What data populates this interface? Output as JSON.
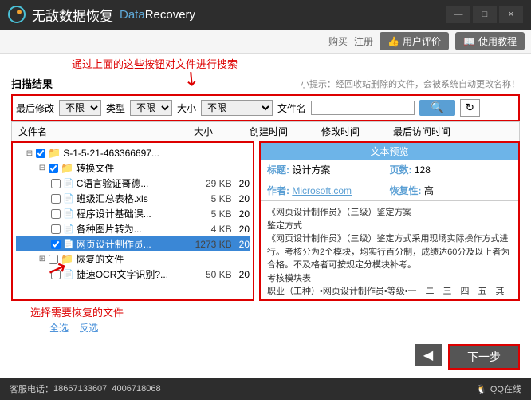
{
  "title": {
    "cn": "无敌数据恢复",
    "en1": "Data",
    "en2": "Recovery"
  },
  "winbtns": {
    "min": "—",
    "max": "□",
    "close": "×"
  },
  "toolbar": {
    "buy": "购买",
    "register": "注册",
    "rating": "用户评价",
    "tutorial": "使用教程"
  },
  "anno": {
    "top": "通过上面的这些按钮对文件进行搜索",
    "left": "选择需要恢复的文件"
  },
  "section": {
    "title": "扫描结果",
    "tip": "小提示：经回收站删除的文件，会被系统自动更改名称！"
  },
  "filter": {
    "lastmod": "最后修改",
    "type": "类型",
    "size": "大小",
    "filename": "文件名",
    "unlimited": "不限"
  },
  "columns": {
    "name": "文件名",
    "size": "大小",
    "created": "创建时间",
    "modified": "修改时间",
    "accessed": "最后访问时间"
  },
  "tree": {
    "root": "S-1-5-21-463366697...",
    "folder1": "转换文件",
    "files": [
      {
        "name": "C语言验证哥德...",
        "size": "29 KB",
        "date": "20"
      },
      {
        "name": "班级汇总表格.xls",
        "size": "5 KB",
        "date": "20"
      },
      {
        "name": "程序设计基础课...",
        "size": "5 KB",
        "date": "20"
      },
      {
        "name": "各种图片转为...",
        "size": "4 KB",
        "date": "20"
      },
      {
        "name": "网页设计制作员...",
        "size": "1273 KB",
        "date": "20"
      },
      {
        "name": "捷速OCR文字识别?...",
        "size": "50 KB",
        "date": "20"
      }
    ],
    "folder2": "恢复的文件"
  },
  "preview": {
    "title": "文本预览",
    "topic_label": "标题:",
    "topic": "设计方案",
    "pages_label": "页数:",
    "pages": "128",
    "author_label": "作者:",
    "author": "Microsoft.com",
    "recover_label": "恢复性:",
    "recover": "高",
    "body": "《网页设计制作员》（三级）鉴定方案\n鉴定方式\n《网页设计制作员》（三级）鉴定方式采用现场实际操作方式进行。考核分为2个模块，均实行百分制，成绩达60分及以上者为合格。不及格者可按规定分模块补考。\n考核模块表\n职业（工种）•网页设计制作员•等级•一　二　三　四　五　其它"
  },
  "select": {
    "all": "全选",
    "invert": "反选"
  },
  "nav": {
    "back": "◀",
    "next": "下一步"
  },
  "footer": {
    "hotline_label": "客服电话：",
    "phone1": "18667133607",
    "phone2": "4006718068",
    "qq": "QQ在线"
  }
}
